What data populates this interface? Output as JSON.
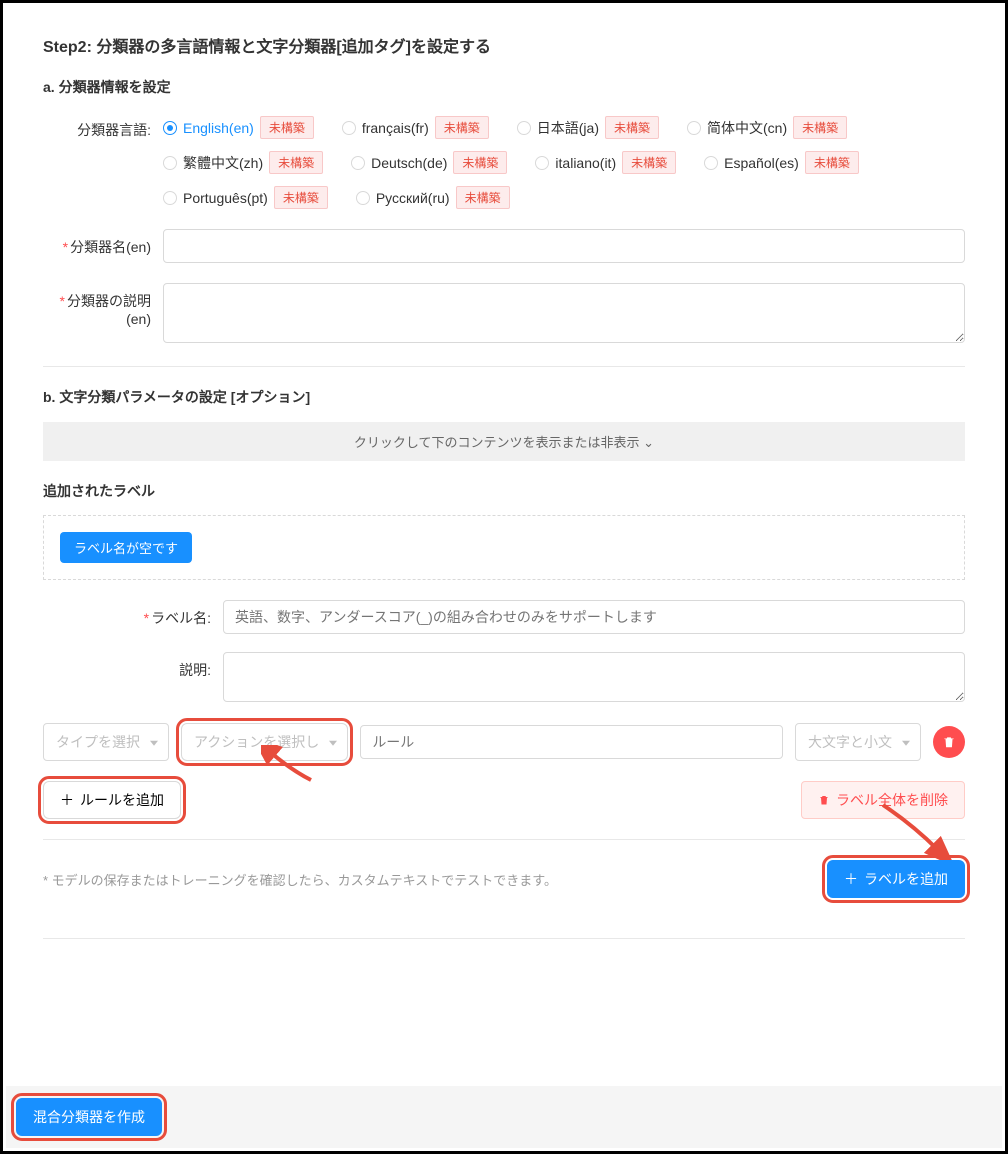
{
  "step_title": "Step2: 分類器の多言語情報と文字分類器[追加タグ]を設定する",
  "section_a": "a. 分類器情報を設定",
  "lang_label": "分類器言語:",
  "languages": [
    {
      "label": "English(en)",
      "selected": true,
      "tag": "未構築"
    },
    {
      "label": "français(fr)",
      "selected": false,
      "tag": "未構築"
    },
    {
      "label": "日本語(ja)",
      "selected": false,
      "tag": "未構築"
    },
    {
      "label": "简体中文(cn)",
      "selected": false,
      "tag": "未構築"
    },
    {
      "label": "繁體中文(zh)",
      "selected": false,
      "tag": "未構築"
    },
    {
      "label": "Deutsch(de)",
      "selected": false,
      "tag": "未構築"
    },
    {
      "label": "italiano(it)",
      "selected": false,
      "tag": "未構築"
    },
    {
      "label": "Español(es)",
      "selected": false,
      "tag": "未構築"
    },
    {
      "label": "Português(pt)",
      "selected": false,
      "tag": "未構築"
    },
    {
      "label": "Русский(ru)",
      "selected": false,
      "tag": "未構築"
    }
  ],
  "classifier_name_label": "分類器名(en)",
  "classifier_desc_label": "分類器の説明(en)",
  "section_b": "b. 文字分類パラメータの設定 [オプション]",
  "collapse_text": "クリックして下のコンテンツを表示または非表示",
  "added_label_title": "追加されたラベル",
  "empty_label_pill": "ラベル名が空です",
  "label_name_label": "ラベル名:",
  "label_name_placeholder": "英語、数字、アンダースコア(_)の組み合わせのみをサポートします",
  "desc_label": "説明:",
  "select_type": "タイプを選択",
  "select_action": "アクションを選択し",
  "rule_placeholder": "ルール",
  "case_select": "大文字と小文",
  "add_rule_btn": "ルールを追加",
  "delete_label_btn": "ラベル全体を削除",
  "note": "* モデルの保存またはトレーニングを確認したら、カスタムテキストでテストできます。",
  "add_label_btn": "ラベルを追加",
  "create_btn": "混合分類器を作成"
}
